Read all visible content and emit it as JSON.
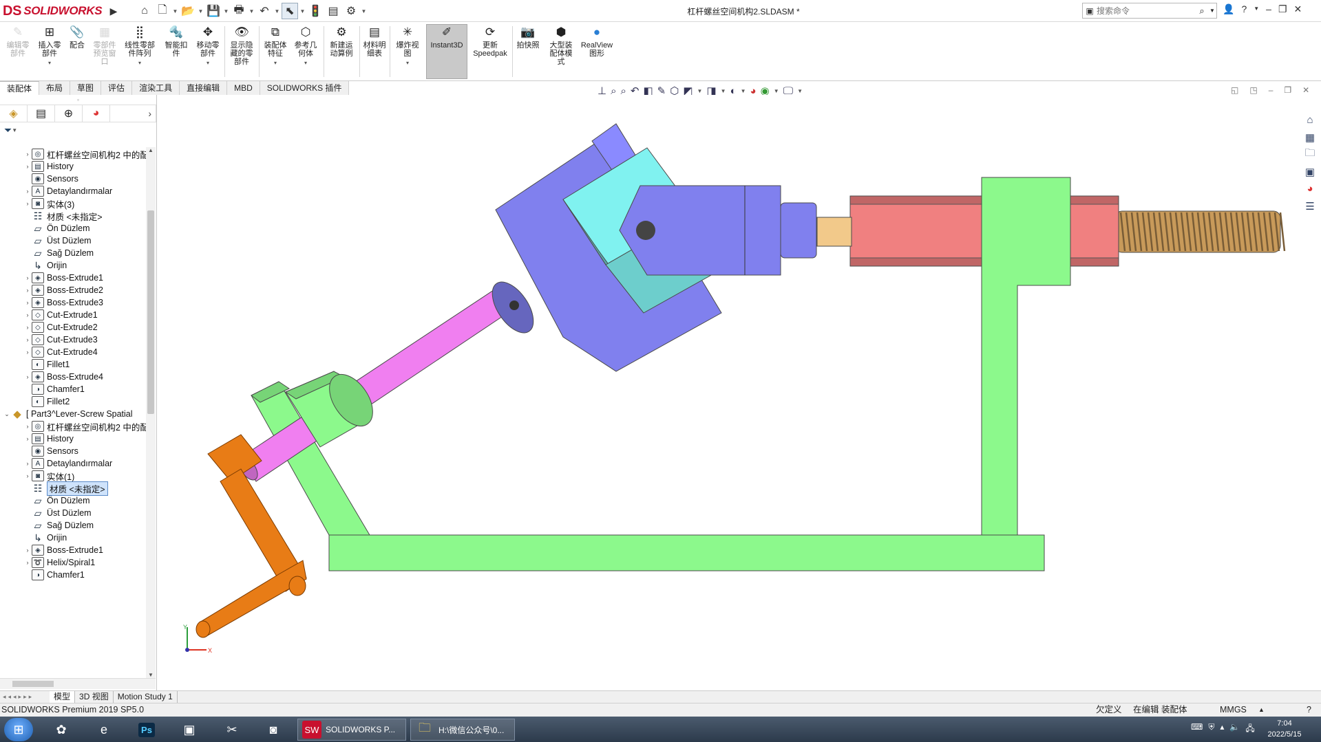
{
  "app": {
    "logo_mark": "DS",
    "logo_text": "SOLIDWORKS",
    "window_title": "杠杆螺丝空间机构2.SLDASM *"
  },
  "search": {
    "placeholder": "搜索命令"
  },
  "ribbon": {
    "buttons": [
      {
        "label": "编辑零部件",
        "disabled": true
      },
      {
        "label": "插入零部件"
      },
      {
        "label": "配合"
      },
      {
        "label": "零部件预览窗口",
        "disabled": true
      },
      {
        "label": "线性零部件阵列"
      },
      {
        "label": "智能扣件"
      },
      {
        "label": "移动零部件"
      },
      {
        "label": "显示隐藏的零部件"
      },
      {
        "label": "装配体特征"
      },
      {
        "label": "参考几何体"
      },
      {
        "label": "新建运动算例"
      },
      {
        "label": "材料明细表"
      },
      {
        "label": "爆炸视图"
      },
      {
        "label": "Instant3D"
      },
      {
        "label": "更新Speedpak"
      },
      {
        "label": "拍快照"
      },
      {
        "label": "大型装配体模式"
      },
      {
        "label": "RealView图形"
      }
    ]
  },
  "tabs": [
    "装配体",
    "布局",
    "草图",
    "评估",
    "渲染工具",
    "直接编辑",
    "MBD",
    "SOLIDWORKS 插件"
  ],
  "tree": {
    "items": [
      {
        "label": "杠杆螺丝空间机构2 中的配",
        "exp": "›",
        "icon": "drawing-icon"
      },
      {
        "label": "History",
        "exp": "›",
        "icon": "history-icon"
      },
      {
        "label": "Sensors",
        "exp": "",
        "icon": "sensor-icon"
      },
      {
        "label": "Detaylandırmalar",
        "exp": "›",
        "icon": "annotation-icon"
      },
      {
        "label": "实体(3)",
        "exp": "›",
        "icon": "solid-bodies-icon"
      },
      {
        "label": "材质 <未指定>",
        "exp": "",
        "icon": "material-icon"
      },
      {
        "label": "Ön Düzlem",
        "exp": "",
        "icon": "plane-icon"
      },
      {
        "label": "Üst Düzlem",
        "exp": "",
        "icon": "plane-icon"
      },
      {
        "label": "Sağ Düzlem",
        "exp": "",
        "icon": "plane-icon"
      },
      {
        "label": "Orijin",
        "exp": "",
        "icon": "origin-icon"
      },
      {
        "label": "Boss-Extrude1",
        "exp": "›",
        "icon": "extrude-icon"
      },
      {
        "label": "Boss-Extrude2",
        "exp": "›",
        "icon": "extrude-icon"
      },
      {
        "label": "Boss-Extrude3",
        "exp": "›",
        "icon": "extrude-icon"
      },
      {
        "label": "Cut-Extrude1",
        "exp": "›",
        "icon": "cut-icon"
      },
      {
        "label": "Cut-Extrude2",
        "exp": "›",
        "icon": "cut-icon"
      },
      {
        "label": "Cut-Extrude3",
        "exp": "›",
        "icon": "cut-icon"
      },
      {
        "label": "Cut-Extrude4",
        "exp": "›",
        "icon": "cut-icon"
      },
      {
        "label": "Fillet1",
        "exp": "",
        "icon": "fillet-icon"
      },
      {
        "label": "Boss-Extrude4",
        "exp": "›",
        "icon": "extrude-icon"
      },
      {
        "label": "Chamfer1",
        "exp": "",
        "icon": "chamfer-icon"
      },
      {
        "label": "Fillet2",
        "exp": "",
        "icon": "fillet-icon"
      },
      {
        "label": "[ Part3^Lever-Screw Spatial",
        "exp": "⌄",
        "icon": "part-icon",
        "root": true
      },
      {
        "label": "杠杆螺丝空间机构2 中的配",
        "exp": "›",
        "icon": "drawing-icon"
      },
      {
        "label": "History",
        "exp": "›",
        "icon": "history-icon"
      },
      {
        "label": "Sensors",
        "exp": "",
        "icon": "sensor-icon"
      },
      {
        "label": "Detaylandırmalar",
        "exp": "›",
        "icon": "annotation-icon"
      },
      {
        "label": "实体(1)",
        "exp": "›",
        "icon": "solid-bodies-icon"
      },
      {
        "label": "材质 <未指定>",
        "exp": "",
        "icon": "material-icon",
        "selected": true
      },
      {
        "label": "Ön Düzlem",
        "exp": "",
        "icon": "plane-icon"
      },
      {
        "label": "Üst Düzlem",
        "exp": "",
        "icon": "plane-icon"
      },
      {
        "label": "Sağ Düzlem",
        "exp": "",
        "icon": "plane-icon"
      },
      {
        "label": "Orijin",
        "exp": "",
        "icon": "origin-icon"
      },
      {
        "label": "Boss-Extrude1",
        "exp": "›",
        "icon": "extrude-icon"
      },
      {
        "label": "Helix/Spiral1",
        "exp": "›",
        "icon": "helix-icon"
      },
      {
        "label": "Chamfer1",
        "exp": "",
        "icon": "chamfer-icon"
      }
    ]
  },
  "bottom_tabs": [
    "模型",
    "3D 视图",
    "Motion Study 1"
  ],
  "status": {
    "product": "SOLIDWORKS Premium 2019 SP5.0",
    "definition": "欠定义",
    "editing": "在编辑 装配体",
    "units": "MMGS",
    "units_arrow": "▲"
  },
  "taskbar": {
    "windows": [
      {
        "label": "SOLIDWORKS P..."
      },
      {
        "label": "H:\\微信公众号\\0..."
      }
    ]
  },
  "clock": {
    "time": "7:04",
    "date": "2022/5/15"
  },
  "triad": {
    "x": "X",
    "y": "Y"
  },
  "colors": {
    "frame": "#8cf98c",
    "yoke": "#8080ee",
    "block": "#80f2f0",
    "rod": "#f07ff0",
    "crank": "#e87c16",
    "nut": "#f08080",
    "screw": "#c89a5a"
  }
}
